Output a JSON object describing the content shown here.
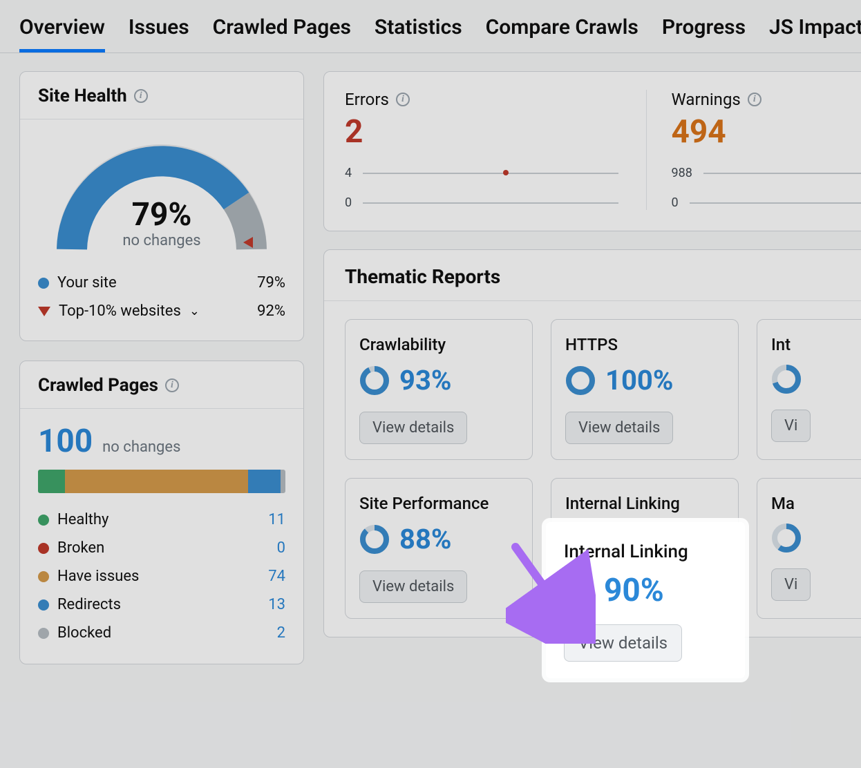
{
  "tabs": [
    "Overview",
    "Issues",
    "Crawled Pages",
    "Statistics",
    "Compare Crawls",
    "Progress",
    "JS Impact"
  ],
  "site_health": {
    "title": "Site Health",
    "percent": "79%",
    "subtitle": "no changes",
    "legend": {
      "your_site_label": "Your site",
      "your_site_value": "79%",
      "top10_label": "Top-10% websites",
      "top10_value": "92%"
    }
  },
  "crawled": {
    "title": "Crawled Pages",
    "count": "100",
    "subtitle": "no changes",
    "rows": [
      {
        "label": "Healthy",
        "value": "11",
        "color": "#3fa66a"
      },
      {
        "label": "Broken",
        "value": "0",
        "color": "#c0392b"
      },
      {
        "label": "Have issues",
        "value": "74",
        "color": "#d49a4a"
      },
      {
        "label": "Redirects",
        "value": "13",
        "color": "#3b8ed0"
      },
      {
        "label": "Blocked",
        "value": "2",
        "color": "#b5bcc2"
      }
    ]
  },
  "topstats": {
    "errors_label": "Errors",
    "errors_value": "2",
    "errors_axis_top": "4",
    "errors_axis_bottom": "0",
    "warnings_label": "Warnings",
    "warnings_value": "494",
    "warnings_axis_top": "988",
    "warnings_axis_bottom": "0"
  },
  "thematic": {
    "title": "Thematic Reports",
    "view_details": "View details",
    "cards": {
      "crawlability": {
        "title": "Crawlability",
        "value": "93%",
        "pct": 93
      },
      "https": {
        "title": "HTTPS",
        "value": "100%",
        "pct": 100
      },
      "intl": {
        "title": "Int",
        "value": "",
        "pct": 70
      },
      "siteperf": {
        "title": "Site Performance",
        "value": "88%",
        "pct": 88
      },
      "internal": {
        "title": "Internal Linking",
        "value": "90%",
        "pct": 90
      },
      "markup": {
        "title": "Ma",
        "value": "",
        "pct": 60
      }
    }
  },
  "colors": {
    "blue": "#3b8ed0",
    "gaugeGray": "#aeb5bb",
    "red": "#c0392b",
    "orange": "#d9731a"
  }
}
